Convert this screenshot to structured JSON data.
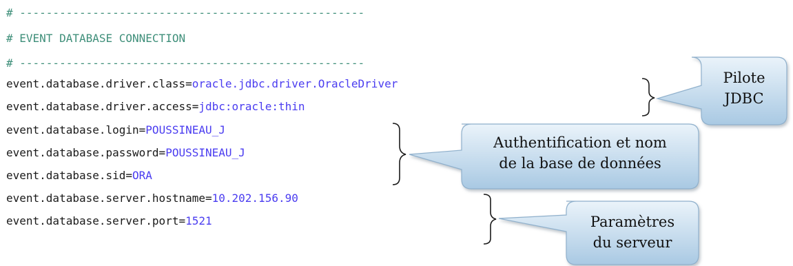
{
  "code": {
    "comment_rule_top": "# ----------------------------------------------------",
    "comment_title": "# EVENT DATABASE CONNECTION",
    "comment_rule_bottom": "# ----------------------------------------------------",
    "lines": [
      {
        "key": "event.database.driver.class=",
        "value": "oracle.jdbc.driver.OracleDriver"
      },
      {
        "key": "event.database.driver.access=",
        "value": "jdbc:oracle:thin"
      },
      {
        "key": "event.database.login=",
        "value": "POUSSINEAU_J"
      },
      {
        "key": "event.database.password=",
        "value": "POUSSINEAU_J"
      },
      {
        "key": "event.database.sid=",
        "value": "ORA"
      },
      {
        "key": "event.database.server.hostname=",
        "value": "10.202.156.90"
      },
      {
        "key": "event.database.server.port=",
        "value": "1521"
      }
    ]
  },
  "callouts": {
    "jdbc": {
      "line1": "Pilote",
      "line2": "JDBC"
    },
    "auth": {
      "line1": "Authentification et nom",
      "line2": "de la base de données"
    },
    "server": {
      "line1": "Paramètres",
      "line2": "du serveur"
    }
  },
  "colors": {
    "comment": "#3f8f7a",
    "key": "#1a1a1a",
    "value": "#4a3cf0",
    "callout_fill_top": "#eaf3fa",
    "callout_fill_bottom": "#a9c9e3"
  }
}
